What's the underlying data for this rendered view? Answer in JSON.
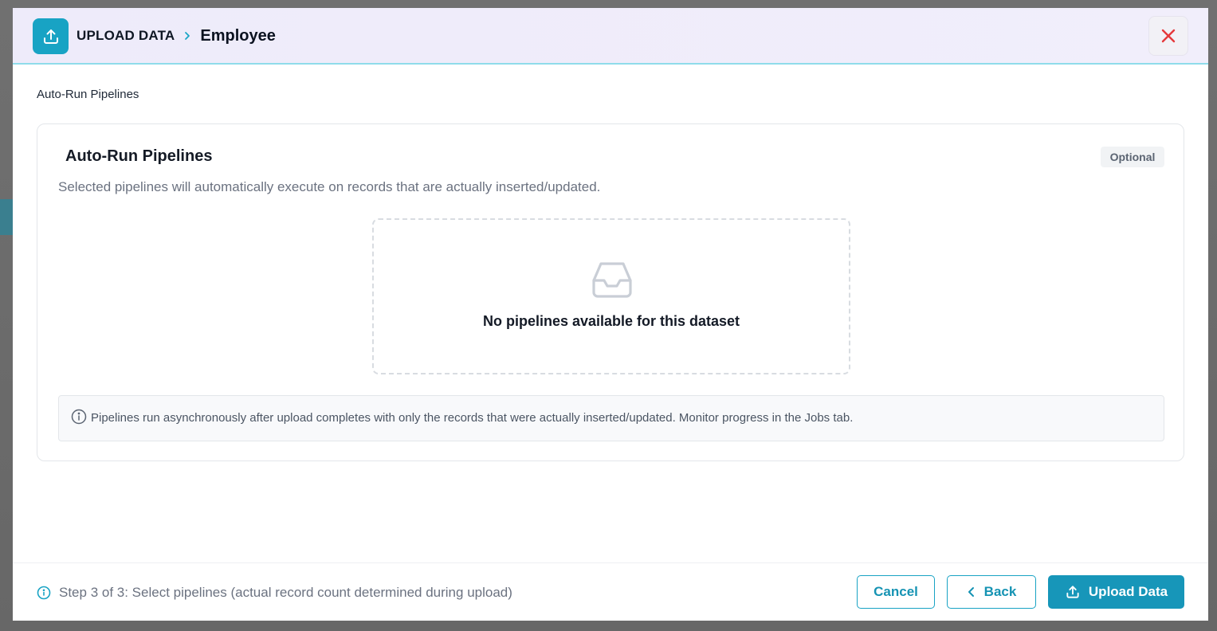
{
  "header": {
    "breadcrumb_root": "UPLOAD DATA",
    "breadcrumb_current": "Employee",
    "header_icon": "upload-icon",
    "close_icon": "close-icon"
  },
  "section_label": "Auto-Run Pipelines",
  "card": {
    "title": "Auto-Run Pipelines",
    "badge": "Optional",
    "description": "Selected pipelines will automatically execute on records that are actually inserted/updated.",
    "empty_state": {
      "icon": "inbox-icon",
      "message": "No pipelines available for this dataset"
    },
    "info": {
      "icon": "info-icon",
      "text": "Pipelines run asynchronously after upload completes with only the records that were actually inserted/updated. Monitor progress in the Jobs tab."
    }
  },
  "footer": {
    "step_text": "Step 3 of 3: Select pipelines (actual record count determined during upload)",
    "buttons": {
      "cancel": "Cancel",
      "back": "Back",
      "upload": "Upload Data"
    }
  },
  "colors": {
    "accent": "#18a3c4",
    "close": "#e5383b",
    "header_bg": "#eeebfa"
  }
}
